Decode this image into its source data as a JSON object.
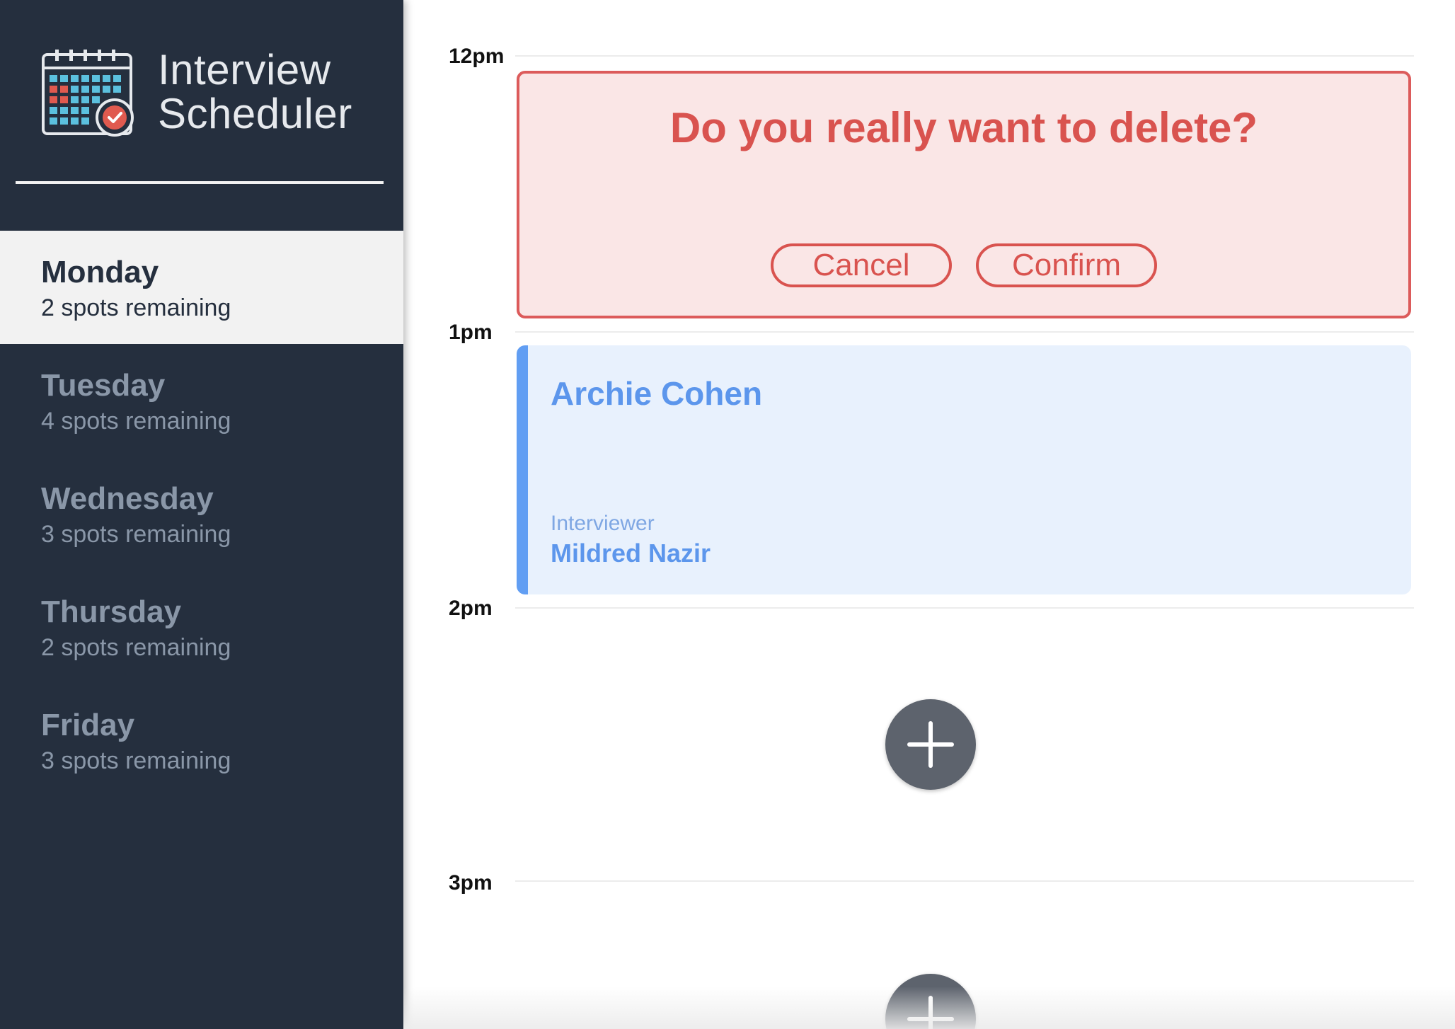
{
  "brand": {
    "line1": "Interview",
    "line2": "Scheduler",
    "logo_icon": "calendar-check-icon"
  },
  "days": [
    {
      "name": "Monday",
      "spots": "2 spots remaining",
      "selected": true
    },
    {
      "name": "Tuesday",
      "spots": "4 spots remaining",
      "selected": false
    },
    {
      "name": "Wednesday",
      "spots": "3 spots remaining",
      "selected": false
    },
    {
      "name": "Thursday",
      "spots": "2 spots remaining",
      "selected": false
    },
    {
      "name": "Friday",
      "spots": "3 spots remaining",
      "selected": false
    }
  ],
  "schedule": {
    "times": [
      "12pm",
      "1pm",
      "2pm",
      "3pm"
    ],
    "confirm": {
      "message": "Do you really want to delete?",
      "cancel_label": "Cancel",
      "confirm_label": "Confirm"
    },
    "appointment": {
      "student": "Archie Cohen",
      "interviewer_label": "Interviewer",
      "interviewer": "Mildred Nazir"
    },
    "add_icon": "plus-icon"
  },
  "colors": {
    "sidebar_bg": "#252f3e",
    "danger": "#d9534f",
    "danger_bg": "#fae6e6",
    "appointment_accent": "#619ef3",
    "appointment_bg": "#e8f1fd",
    "add_button": "#5d636d"
  }
}
